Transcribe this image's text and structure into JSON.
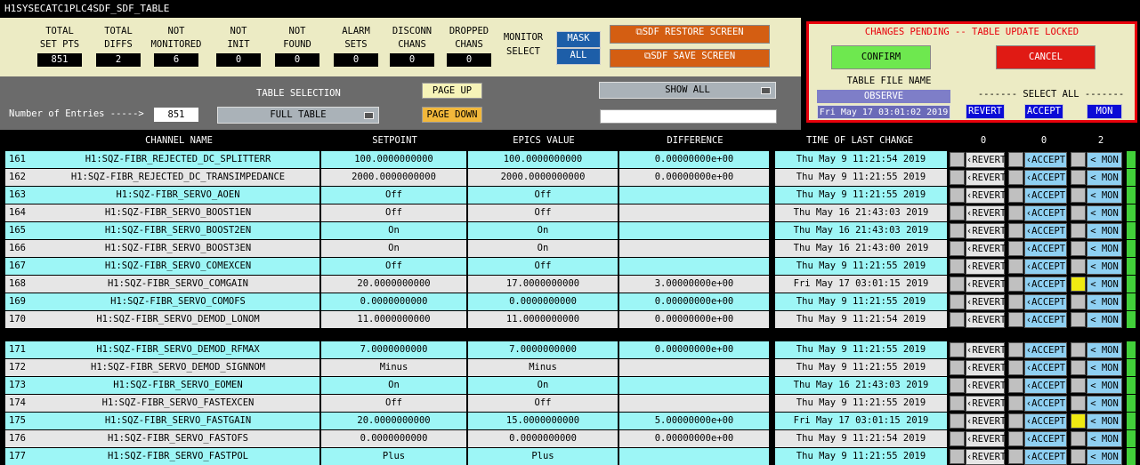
{
  "window": {
    "title": "H1SYSECATC1PLC4SDF_SDF_TABLE"
  },
  "stats": [
    {
      "label": "TOTAL\nSET PTS",
      "value": "851"
    },
    {
      "label": "TOTAL\nDIFFS",
      "value": "2"
    },
    {
      "label": "NOT\nMONITORED",
      "value": "6"
    },
    {
      "label": "NOT\nINIT",
      "value": "0"
    },
    {
      "label": "NOT\nFOUND",
      "value": "0"
    },
    {
      "label": "ALARM\nSETS",
      "value": "0"
    },
    {
      "label": "DISCONN\nCHANS",
      "value": "0"
    },
    {
      "label": "DROPPED\nCHANS",
      "value": "0"
    }
  ],
  "monitor_select": {
    "label": "MONITOR\nSELECT",
    "mask": "MASK",
    "all": "ALL"
  },
  "sdf": {
    "restore": "⧉SDF RESTORE SCREEN",
    "save": "⧉SDF SAVE SCREEN"
  },
  "pending": {
    "message": "CHANGES PENDING -- TABLE UPDATE LOCKED",
    "confirm": "CONFIRM",
    "cancel": "CANCEL",
    "file_label": "TABLE FILE NAME",
    "file_name": "OBSERVE",
    "file_time": "Fri May 17 03:01:02 2019",
    "select_all": "------- SELECT ALL -------",
    "revert": "REVERT",
    "accept": "ACCEPT",
    "mon": "MON"
  },
  "controls": {
    "entries_label": "Number of Entries ----->",
    "entries_value": "851",
    "table_selection_label": "TABLE SELECTION",
    "table_selection_value": "FULL TABLE",
    "page_up": "PAGE UP",
    "page_down": "PAGE DOWN",
    "show_value": "SHOW ALL",
    "filter_value": ""
  },
  "columns": {
    "channel": "CHANNEL NAME",
    "setpoint": "SETPOINT",
    "epics": "EPICS VALUE",
    "difference": "DIFFERENCE",
    "time": "TIME OF LAST CHANGE",
    "revert_count": "0",
    "accept_count": "0",
    "mon_count": "2"
  },
  "row_buttons": {
    "revert": "‹REVERT",
    "accept": "‹ACCEPT",
    "mon": "< MON"
  },
  "rows": [
    {
      "num": "161",
      "channel": "H1:SQZ-FIBR_REJECTED_DC_SPLITTERR",
      "setpoint": "100.0000000000",
      "epics": "100.0000000000",
      "diff": "0.00000000e+00",
      "time": "Thu May  9 11:21:54 2019",
      "flag": false
    },
    {
      "num": "162",
      "channel": "H1:SQZ-FIBR_REJECTED_DC_TRANSIMPEDANCE",
      "setpoint": "2000.0000000000",
      "epics": "2000.0000000000",
      "diff": "0.00000000e+00",
      "time": "Thu May  9 11:21:55 2019",
      "flag": false
    },
    {
      "num": "163",
      "channel": "H1:SQZ-FIBR_SERVO_AOEN",
      "setpoint": "Off",
      "epics": "Off",
      "diff": "",
      "time": "Thu May  9 11:21:55 2019",
      "flag": false
    },
    {
      "num": "164",
      "channel": "H1:SQZ-FIBR_SERVO_BOOST1EN",
      "setpoint": "Off",
      "epics": "Off",
      "diff": "",
      "time": "Thu May 16 21:43:03 2019",
      "flag": false
    },
    {
      "num": "165",
      "channel": "H1:SQZ-FIBR_SERVO_BOOST2EN",
      "setpoint": "On",
      "epics": "On",
      "diff": "",
      "time": "Thu May 16 21:43:03 2019",
      "flag": false
    },
    {
      "num": "166",
      "channel": "H1:SQZ-FIBR_SERVO_BOOST3EN",
      "setpoint": "On",
      "epics": "On",
      "diff": "",
      "time": "Thu May 16 21:43:00 2019",
      "flag": false
    },
    {
      "num": "167",
      "channel": "H1:SQZ-FIBR_SERVO_COMEXCEN",
      "setpoint": "Off",
      "epics": "Off",
      "diff": "",
      "time": "Thu May  9 11:21:55 2019",
      "flag": false
    },
    {
      "num": "168",
      "channel": "H1:SQZ-FIBR_SERVO_COMGAIN",
      "setpoint": "20.0000000000",
      "epics": "17.0000000000",
      "diff": "3.00000000e+00",
      "time": "Fri May 17 03:01:15 2019",
      "flag": true
    },
    {
      "num": "169",
      "channel": "H1:SQZ-FIBR_SERVO_COMOFS",
      "setpoint": "0.0000000000",
      "epics": "0.0000000000",
      "diff": "0.00000000e+00",
      "time": "Thu May  9 11:21:55 2019",
      "flag": false
    },
    {
      "num": "170",
      "channel": "H1:SQZ-FIBR_SERVO_DEMOD_LONOM",
      "setpoint": "11.0000000000",
      "epics": "11.0000000000",
      "diff": "0.00000000e+00",
      "time": "Thu May  9 11:21:54 2019",
      "flag": false
    },
    {
      "num": "171",
      "channel": "H1:SQZ-FIBR_SERVO_DEMOD_RFMAX",
      "setpoint": "7.0000000000",
      "epics": "7.0000000000",
      "diff": "0.00000000e+00",
      "time": "Thu May  9 11:21:55 2019",
      "flag": false
    },
    {
      "num": "172",
      "channel": "H1:SQZ-FIBR_SERVO_DEMOD_SIGNNOM",
      "setpoint": "Minus",
      "epics": "Minus",
      "diff": "",
      "time": "Thu May  9 11:21:55 2019",
      "flag": false
    },
    {
      "num": "173",
      "channel": "H1:SQZ-FIBR_SERVO_EOMEN",
      "setpoint": "On",
      "epics": "On",
      "diff": "",
      "time": "Thu May 16 21:43:03 2019",
      "flag": false
    },
    {
      "num": "174",
      "channel": "H1:SQZ-FIBR_SERVO_FASTEXCEN",
      "setpoint": "Off",
      "epics": "Off",
      "diff": "",
      "time": "Thu May  9 11:21:55 2019",
      "flag": false
    },
    {
      "num": "175",
      "channel": "H1:SQZ-FIBR_SERVO_FASTGAIN",
      "setpoint": "20.0000000000",
      "epics": "15.0000000000",
      "diff": "5.00000000e+00",
      "time": "Fri May 17 03:01:15 2019",
      "flag": true
    },
    {
      "num": "176",
      "channel": "H1:SQZ-FIBR_SERVO_FASTOFS",
      "setpoint": "0.0000000000",
      "epics": "0.0000000000",
      "diff": "0.00000000e+00",
      "time": "Thu May  9 11:21:54 2019",
      "flag": false
    },
    {
      "num": "177",
      "channel": "H1:SQZ-FIBR_SERVO_FASTPOL",
      "setpoint": "Plus",
      "epics": "Plus",
      "diff": "",
      "time": "Thu May  9 11:21:55 2019",
      "flag": false
    }
  ],
  "colors": {
    "row_cyan": "#9df6f6",
    "row_grey": "#e6e6e6",
    "panel_bg": "#ecebc4",
    "confirm_green": "#6ee84f",
    "cancel_red": "#e01a14",
    "accept_blue": "#8fd0f2",
    "flag_yellow": "#f0ea12"
  }
}
